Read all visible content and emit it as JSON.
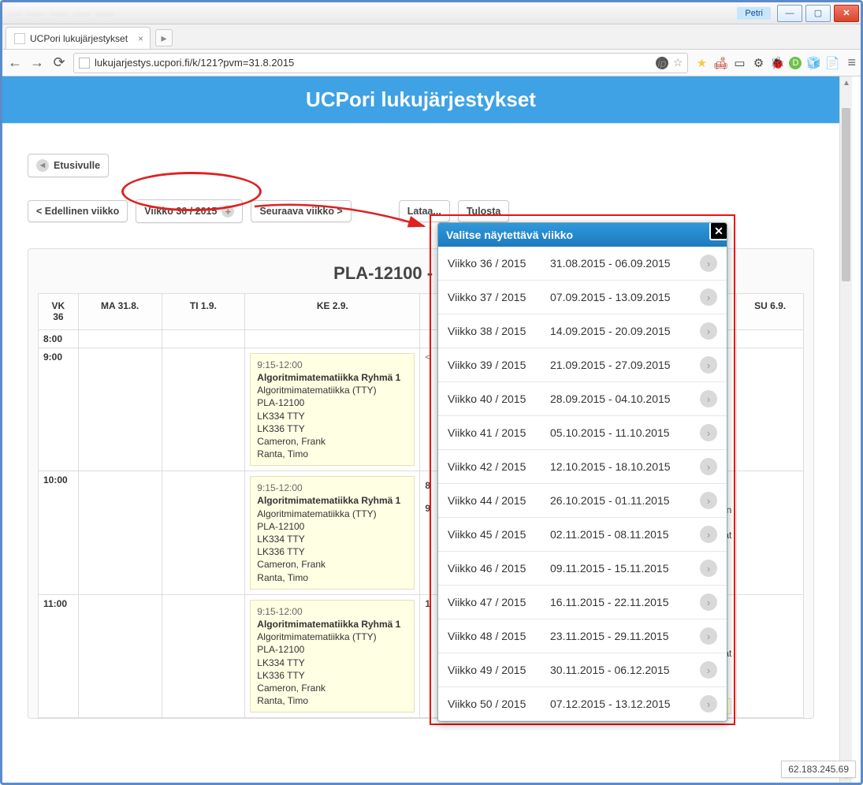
{
  "window": {
    "user_label": "Petri",
    "tab_title": "UCPori lukujärjestykset"
  },
  "browser": {
    "url": "lukujarjestys.ucpori.fi/k/121?pvm=31.8.2015"
  },
  "page": {
    "header_title": "UCPori lukujärjestykset",
    "home_btn": "Etusivulle",
    "prev_week_btn": "< Edellinen viikko",
    "week_btn": "Viikko 36 / 2015",
    "next_week_btn": "Seuraava viikko >",
    "load_btn": "Lataa...",
    "print_btn": "Tulosta"
  },
  "schedule": {
    "course_title": "PLA-12100 - Algoritm",
    "week_header": "VK 36",
    "days": [
      "MA 31.8.",
      "TI 1.9.",
      "KE 2.9.",
      "SU 6.9."
    ],
    "times": [
      "8:00",
      "9:00",
      "10:00",
      "11:00"
    ],
    "partial_left": "< ",
    "partial_mid1": "8",
    "partial_mid2": "9",
    "partial_mid3": "1",
    "partial_right_n": "n",
    "partial_right_at": "at",
    "partial_right_at2": "at",
    "partial_bottom_name": "Cameron, Frank",
    "event": {
      "time": "9:15-12:00",
      "title": "Algoritmimatematiikka Ryhmä 1",
      "l1": "Algoritmimatematiikka (TTY)",
      "l2": "PLA-12100",
      "l3": "LK334 TTY",
      "l4": "LK336 TTY",
      "l5": "Cameron, Frank",
      "l6": "Ranta, Timo"
    }
  },
  "popup": {
    "title": "Valitse näytettävä viikko",
    "items": [
      {
        "wk": "Viikko 36 / 2015",
        "range": "31.08.2015 - 06.09.2015"
      },
      {
        "wk": "Viikko 37 / 2015",
        "range": "07.09.2015 - 13.09.2015"
      },
      {
        "wk": "Viikko 38 / 2015",
        "range": "14.09.2015 - 20.09.2015"
      },
      {
        "wk": "Viikko 39 / 2015",
        "range": "21.09.2015 - 27.09.2015"
      },
      {
        "wk": "Viikko 40 / 2015",
        "range": "28.09.2015 - 04.10.2015"
      },
      {
        "wk": "Viikko 41 / 2015",
        "range": "05.10.2015 - 11.10.2015"
      },
      {
        "wk": "Viikko 42 / 2015",
        "range": "12.10.2015 - 18.10.2015"
      },
      {
        "wk": "Viikko 44 / 2015",
        "range": "26.10.2015 - 01.11.2015"
      },
      {
        "wk": "Viikko 45 / 2015",
        "range": "02.11.2015 - 08.11.2015"
      },
      {
        "wk": "Viikko 46 / 2015",
        "range": "09.11.2015 - 15.11.2015"
      },
      {
        "wk": "Viikko 47 / 2015",
        "range": "16.11.2015 - 22.11.2015"
      },
      {
        "wk": "Viikko 48 / 2015",
        "range": "23.11.2015 - 29.11.2015"
      },
      {
        "wk": "Viikko 49 / 2015",
        "range": "30.11.2015 - 06.12.2015"
      },
      {
        "wk": "Viikko 50 / 2015",
        "range": "07.12.2015 - 13.12.2015"
      }
    ]
  },
  "status": {
    "ip": "62.183.245.69"
  }
}
